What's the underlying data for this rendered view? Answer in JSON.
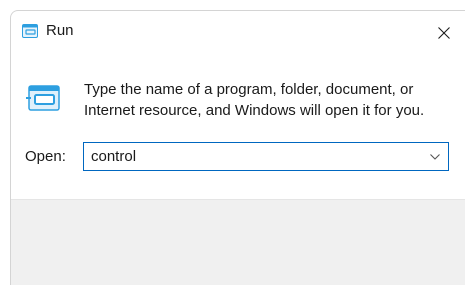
{
  "window": {
    "title": "Run",
    "title_icon": "run-app-icon",
    "close_icon": "close-icon"
  },
  "dialog": {
    "icon": "run-app-icon",
    "description": "Type the name of a program, folder, document, or Internet resource, and Windows will open it for you.",
    "open_label": "Open:",
    "open_value": "control",
    "dropdown_icon": "chevron-down-icon"
  },
  "colors": {
    "accent": "#0067c0",
    "footer_bg": "#f0f0f0",
    "icon_blue": "#2d9fe0"
  }
}
